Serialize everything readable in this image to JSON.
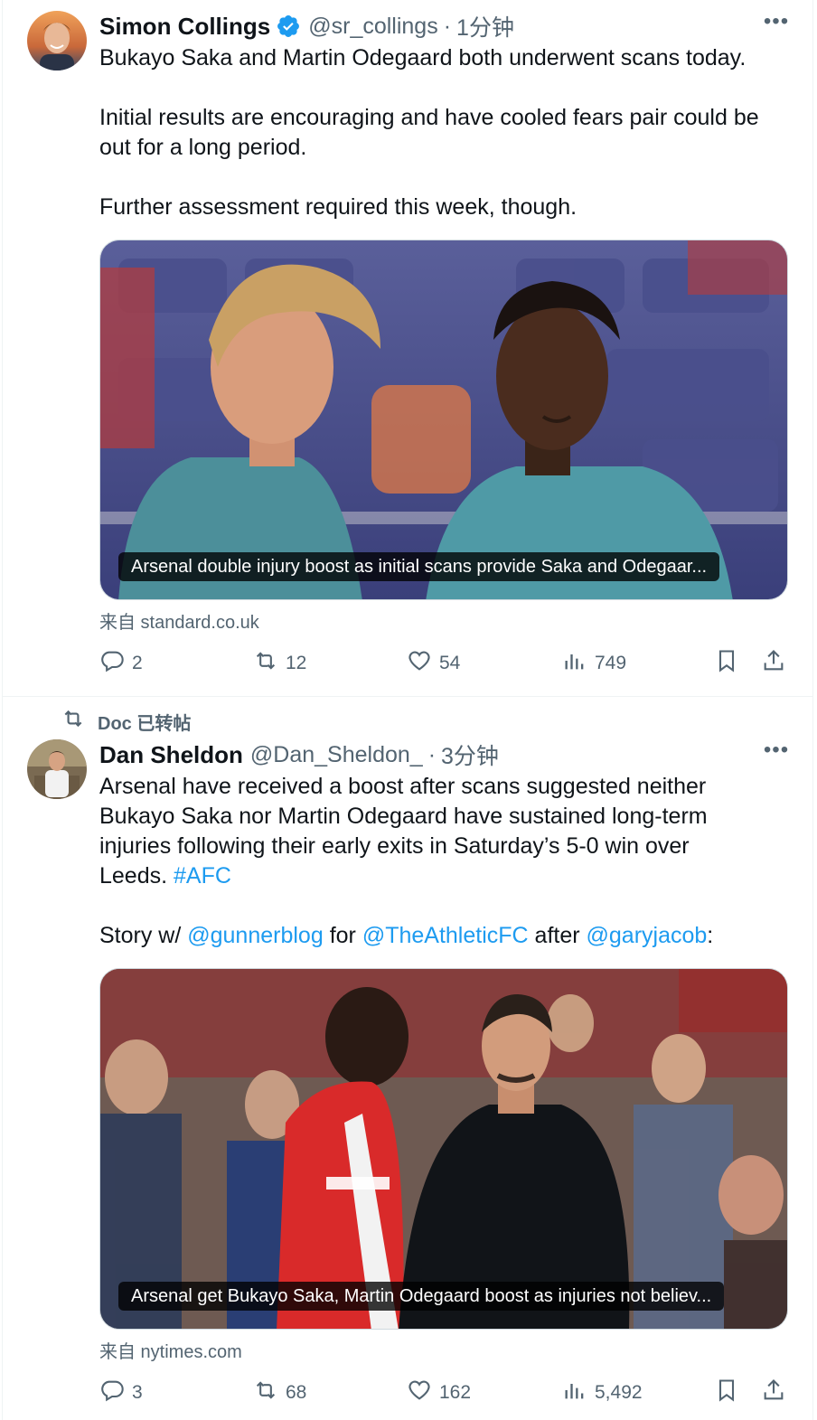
{
  "tweets": [
    {
      "author_name": "Simon Collings",
      "handle": "@sr_collings",
      "separator": "·",
      "time": "1分钟",
      "verified": true,
      "text_lines": [
        "Bukayo Saka and Martin Odegaard both underwent scans today.",
        "Initial results are encouraging and have cooled fears pair could be out for a long period.",
        "Further assessment required this week, though."
      ],
      "card_caption": "Arsenal double injury boost as initial scans provide Saka and Odegaar...",
      "source": "来自 standard.co.uk",
      "stats": {
        "replies": "2",
        "reposts": "12",
        "likes": "54",
        "views": "749"
      }
    },
    {
      "repost_label": "Doc 已转帖",
      "author_name": "Dan Sheldon",
      "handle": "@Dan_Sheldon_",
      "separator": "·",
      "time": "3分钟",
      "text_main": "Arsenal have received a boost after scans suggested neither Bukayo Saka nor Martin Odegaard have sustained long-term injuries following their early exits in Saturday’s 5-0 win over Leeds. ",
      "hashtag": "#AFC",
      "story_prefix": "Story w/ ",
      "mention1": "@gunnerblog",
      "story_for": " for ",
      "mention2": "@TheAthleticFC",
      "story_after": " after ",
      "mention3": "@garyjacob",
      "story_end": ":",
      "card_caption": "Arsenal get Bukayo Saka, Martin Odegaard boost as injuries not believ...",
      "source": "来自 nytimes.com",
      "stats": {
        "replies": "3",
        "reposts": "68",
        "likes": "162",
        "views": "5,492"
      }
    }
  ],
  "icons": {
    "more": "more-horizontal-icon",
    "reply": "reply-icon",
    "repost": "repost-icon",
    "like": "heart-icon",
    "views": "views-icon",
    "bookmark": "bookmark-icon",
    "share": "share-icon"
  },
  "colors": {
    "link": "#1d9bf0",
    "secondary_text": "#536471",
    "verified": "#1d9bf0"
  }
}
